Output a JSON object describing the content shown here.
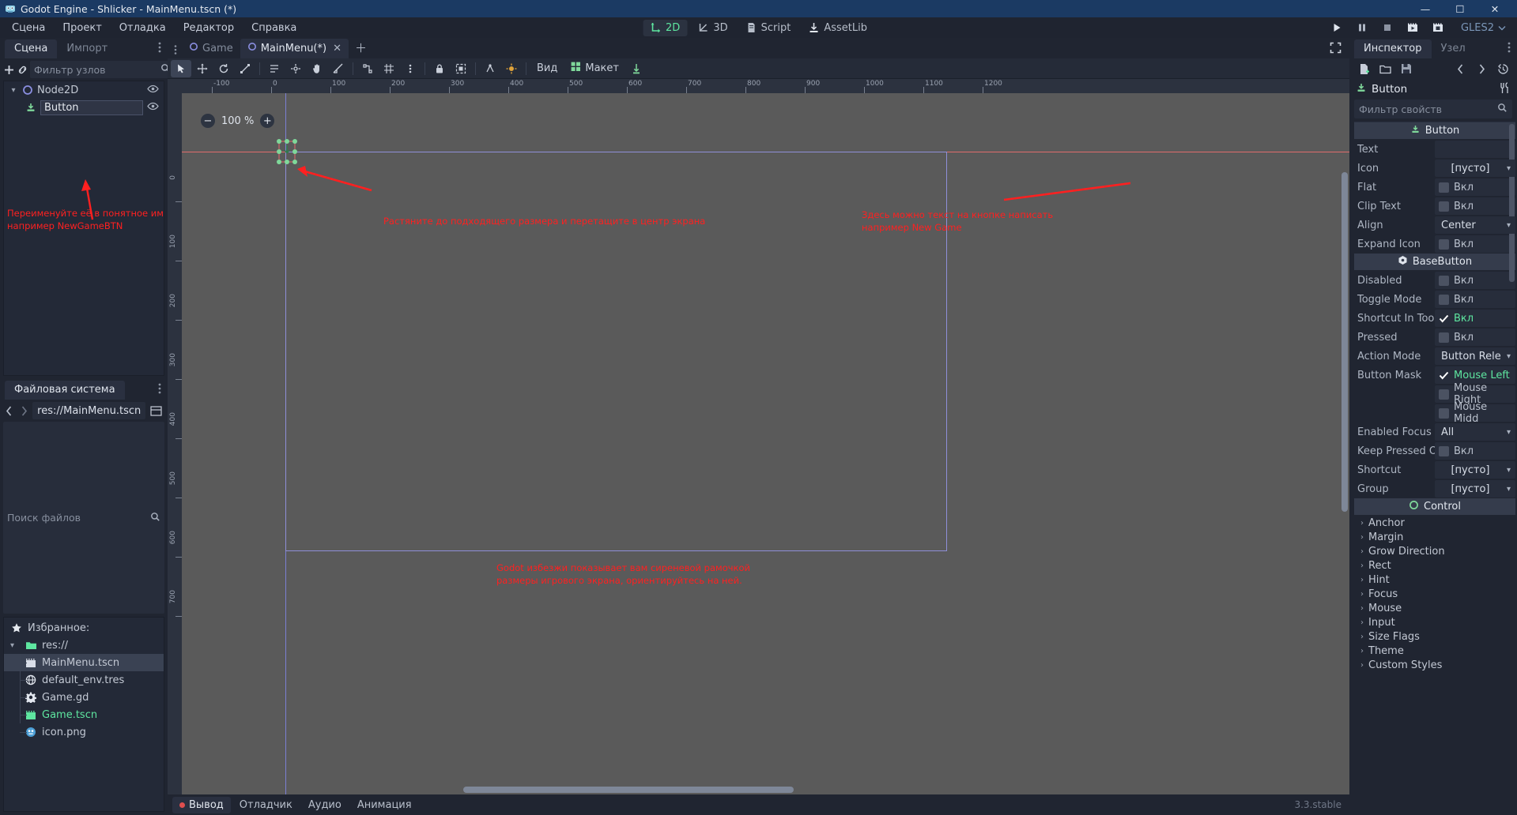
{
  "window": {
    "title": "Godot Engine - Shlicker - MainMenu.tscn (*)",
    "minimize": "—",
    "maximize": "☐",
    "close": "✕"
  },
  "menu": {
    "items": [
      "Сцена",
      "Проект",
      "Отладка",
      "Редактор",
      "Справка"
    ]
  },
  "main_tabs": [
    {
      "label": "2D",
      "active": true
    },
    {
      "label": "3D",
      "active": false
    },
    {
      "label": "Script",
      "active": false
    },
    {
      "label": "AssetLib",
      "active": false
    }
  ],
  "playback": {
    "play": "play-icon",
    "pause": "pause-icon",
    "stop": "stop-icon",
    "play_scene": "play-scene-icon",
    "play_custom": "play-custom-icon",
    "renderer": "GLES2"
  },
  "scene_dock": {
    "tabs": [
      {
        "label": "Сцена",
        "active": true
      },
      {
        "label": "Импорт",
        "active": false
      }
    ],
    "filter_placeholder": "Фильтр узлов",
    "nodes": [
      {
        "label": "Node2D",
        "depth": 0,
        "icon": "node2d-icon",
        "selected": false
      },
      {
        "label": "Button",
        "depth": 1,
        "icon": "button-icon",
        "selected": true,
        "renaming": true
      }
    ]
  },
  "filesystem_dock": {
    "title": "Файловая система",
    "path": "res://MainMenu.tscn",
    "search_placeholder": "Поиск файлов",
    "entries": [
      {
        "label": "Избранное:",
        "icon": "star-icon",
        "depth": 0,
        "kind": "favorites"
      },
      {
        "label": "res://",
        "icon": "folder-icon",
        "depth": 0,
        "kind": "folder"
      },
      {
        "label": "MainMenu.tscn",
        "icon": "scene-icon",
        "depth": 1,
        "kind": "scene",
        "selected": true
      },
      {
        "label": "default_env.tres",
        "icon": "resource-icon",
        "depth": 1,
        "kind": "resource"
      },
      {
        "label": "Game.gd",
        "icon": "script-icon",
        "depth": 1,
        "kind": "script"
      },
      {
        "label": "Game.tscn",
        "icon": "scene-icon",
        "depth": 1,
        "kind": "scene",
        "main": true
      },
      {
        "label": "icon.png",
        "icon": "image-icon",
        "depth": 1,
        "kind": "image"
      }
    ]
  },
  "scene_tabs": [
    {
      "label": "Game",
      "active": false
    },
    {
      "label": "MainMenu(*)",
      "active": true,
      "closable": true
    }
  ],
  "viewport": {
    "zoom": "100 %",
    "zoom_out": "−",
    "zoom_in": "+",
    "menus": [
      "Вид",
      "Макет"
    ],
    "ruler_top_labels": [
      "-100",
      "0",
      "100",
      "200",
      "300",
      "400",
      "500",
      "600",
      "700",
      "800",
      "900",
      "1000",
      "1100",
      "1200"
    ],
    "ruler_left_labels": [
      "0",
      "100",
      "200",
      "300",
      "400",
      "500",
      "600",
      "700"
    ],
    "annotations": [
      {
        "id": "rename-hint",
        "text": "Переименуйте её в понятное имя\nнапример NewGameBTN"
      },
      {
        "id": "resize-hint",
        "text": "Растяните до подходящего размера и перетащите в центр экрана"
      },
      {
        "id": "text-hint",
        "text": "Здесь можно текст на кнопке написать\nнапример New Game"
      },
      {
        "id": "frame-hint",
        "text": "Godot избезжи показывает вам сиреневой рамочкой\nразмеры игрового экрана, ориентируйтесь на ней."
      }
    ]
  },
  "bottom_panel": {
    "tabs": [
      {
        "label": "Вывод",
        "active": true,
        "dot": true
      },
      {
        "label": "Отладчик",
        "active": false
      },
      {
        "label": "Аудио",
        "active": false
      },
      {
        "label": "Анимация",
        "active": false
      }
    ],
    "version": "3.3.stable"
  },
  "inspector": {
    "tabs": [
      {
        "label": "Инспектор",
        "active": true
      },
      {
        "label": "Узел",
        "active": false
      }
    ],
    "node_name": "Button",
    "filter_placeholder": "Фильтр свойств",
    "toolbar_icons": [
      "new-resource-icon",
      "load-icon",
      "save-icon",
      "history-prev-icon",
      "history-next-icon",
      "history-icon",
      "tools-icon"
    ],
    "labels": {
      "on": "Вкл",
      "empty": "[пусто]"
    },
    "sections": [
      {
        "type": "category",
        "label": "Button",
        "icon": "button-icon"
      },
      {
        "type": "text",
        "name": "Text",
        "value": ""
      },
      {
        "type": "enum",
        "name": "Icon",
        "value": "[пусто]"
      },
      {
        "type": "bool",
        "name": "Flat",
        "value": "Вкл",
        "checked": false
      },
      {
        "type": "bool",
        "name": "Clip Text",
        "value": "Вкл",
        "checked": false
      },
      {
        "type": "enum",
        "name": "Align",
        "value": "Center"
      },
      {
        "type": "bool",
        "name": "Expand Icon",
        "value": "Вкл",
        "checked": false
      },
      {
        "type": "category",
        "label": "BaseButton",
        "icon": "basebutton-icon"
      },
      {
        "type": "bool",
        "name": "Disabled",
        "value": "Вкл",
        "checked": false
      },
      {
        "type": "bool",
        "name": "Toggle Mode",
        "value": "Вкл",
        "checked": false
      },
      {
        "type": "bool",
        "name": "Shortcut In Tool",
        "value": "Вкл",
        "checked": true
      },
      {
        "type": "bool",
        "name": "Pressed",
        "value": "Вкл",
        "checked": false
      },
      {
        "type": "enum",
        "name": "Action Mode",
        "value": "Button Rele"
      },
      {
        "type": "bool",
        "name": "Button Mask",
        "value": "Mouse Left",
        "checked": true
      },
      {
        "type": "bool",
        "name": "",
        "value": "Mouse Right",
        "checked": false
      },
      {
        "type": "bool",
        "name": "",
        "value": "Mouse Midd",
        "checked": false
      },
      {
        "type": "enum",
        "name": "Enabled Focus",
        "value": "All"
      },
      {
        "type": "bool",
        "name": "Keep Pressed O",
        "value": "Вкл",
        "checked": false
      },
      {
        "type": "enum",
        "name": "Shortcut",
        "value": "[пусто]"
      },
      {
        "type": "enum",
        "name": "Group",
        "value": "[пусто]"
      },
      {
        "type": "category",
        "label": "Control",
        "icon": "control-icon"
      },
      {
        "type": "fold",
        "name": "Anchor"
      },
      {
        "type": "fold",
        "name": "Margin"
      },
      {
        "type": "fold",
        "name": "Grow Direction"
      },
      {
        "type": "fold",
        "name": "Rect"
      },
      {
        "type": "fold",
        "name": "Hint"
      },
      {
        "type": "fold",
        "name": "Focus"
      },
      {
        "type": "fold",
        "name": "Mouse"
      },
      {
        "type": "fold",
        "name": "Input"
      },
      {
        "type": "fold",
        "name": "Size Flags"
      },
      {
        "type": "fold",
        "name": "Theme"
      },
      {
        "type": "fold",
        "name": "Custom Styles"
      }
    ]
  }
}
